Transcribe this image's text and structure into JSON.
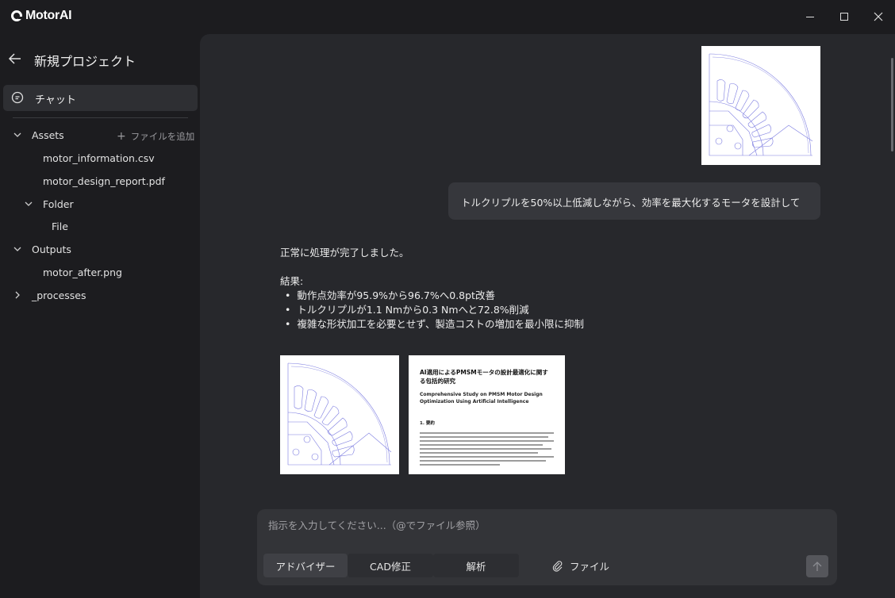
{
  "app": {
    "name": "MotorAI"
  },
  "sidebar": {
    "project_title": "新規プロジェクト",
    "chat_label": "チャット",
    "assets": {
      "label": "Assets",
      "add_file_label": "ファイルを追加",
      "files": [
        "motor_information.csv",
        "motor_design_report.pdf"
      ],
      "folder": {
        "label": "Folder",
        "files": [
          "File"
        ]
      }
    },
    "outputs": {
      "label": "Outputs",
      "files": [
        "motor_after.png"
      ]
    },
    "processes": {
      "label": "_processes"
    }
  },
  "chat": {
    "user_message": "トルクリプルを50%以上低減しながら、効率を最大化するモータを設計して",
    "ai_status": "正常に処理が完了しました。",
    "ai_result_heading": "結果:",
    "ai_results": [
      "動作点効率が95.9%から96.7%へ0.8pt改善",
      "トルクリプルが1.1 Nmから0.3 Nmへと72.8%削減",
      "複雑な形状加工を必要とせず、製造コストの増加を最小限に抑制"
    ],
    "paper": {
      "title": "AI適用によるPMSMモータの設計最適化に関する包括的研究",
      "subtitle": "Comprehensive Study on PMSM Motor Design Optimization Using Artificial Intelligence",
      "section": "1. 要約"
    }
  },
  "composer": {
    "placeholder": "指示を入力してください...（@でファイル参照）",
    "modes": [
      "アドバイザー",
      "CAD修正",
      "解析"
    ],
    "file_label": "ファイル"
  },
  "colors": {
    "background": "#1c1c1f",
    "panel": "#27282c",
    "motor_lines": "#7b7be0"
  }
}
